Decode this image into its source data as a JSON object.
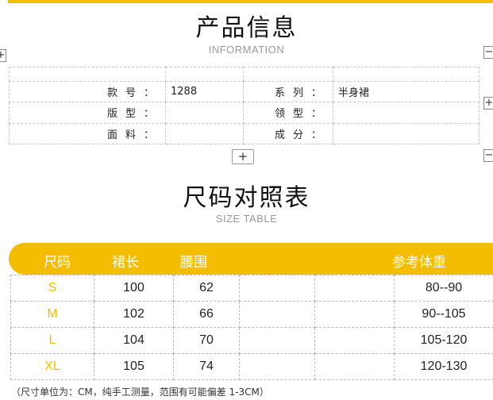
{
  "info_section": {
    "title": "产品信息",
    "subtitle": "INFORMATION",
    "fields": {
      "style_no_label": "款号：",
      "style_no_value": "1288",
      "series_label": "系列：",
      "series_value": "半身裙",
      "pattern_label": "版型：",
      "pattern_value": "",
      "collar_label": "领型：",
      "collar_value": "",
      "fabric_label": "面料：",
      "fabric_value": "",
      "composition_label": "成分：",
      "composition_value": ""
    }
  },
  "size_section": {
    "title": "尺码对照表",
    "subtitle": "SIZE TABLE",
    "headers": [
      "尺码",
      "裙长",
      "腰围",
      "参考体重"
    ],
    "rows": [
      {
        "size": "S",
        "length": "100",
        "waist": "62",
        "weight": "80--90"
      },
      {
        "size": "M",
        "length": "102",
        "waist": "66",
        "weight": "90--105"
      },
      {
        "size": "L",
        "length": "104",
        "waist": "70",
        "weight": "105-120"
      },
      {
        "size": "XL",
        "length": "105",
        "waist": "74",
        "weight": "120-130"
      }
    ],
    "note": "（尺寸单位为：CM，纯手工测量，范围有可能偏差 1-3CM）"
  },
  "controls": {
    "add_symbol": "+",
    "left_edge_symbol": "+",
    "right_edge_symbols": [
      "−",
      "+",
      "−"
    ]
  },
  "colors": {
    "accent": "#f5bd00",
    "header_text": "#ffffff"
  }
}
